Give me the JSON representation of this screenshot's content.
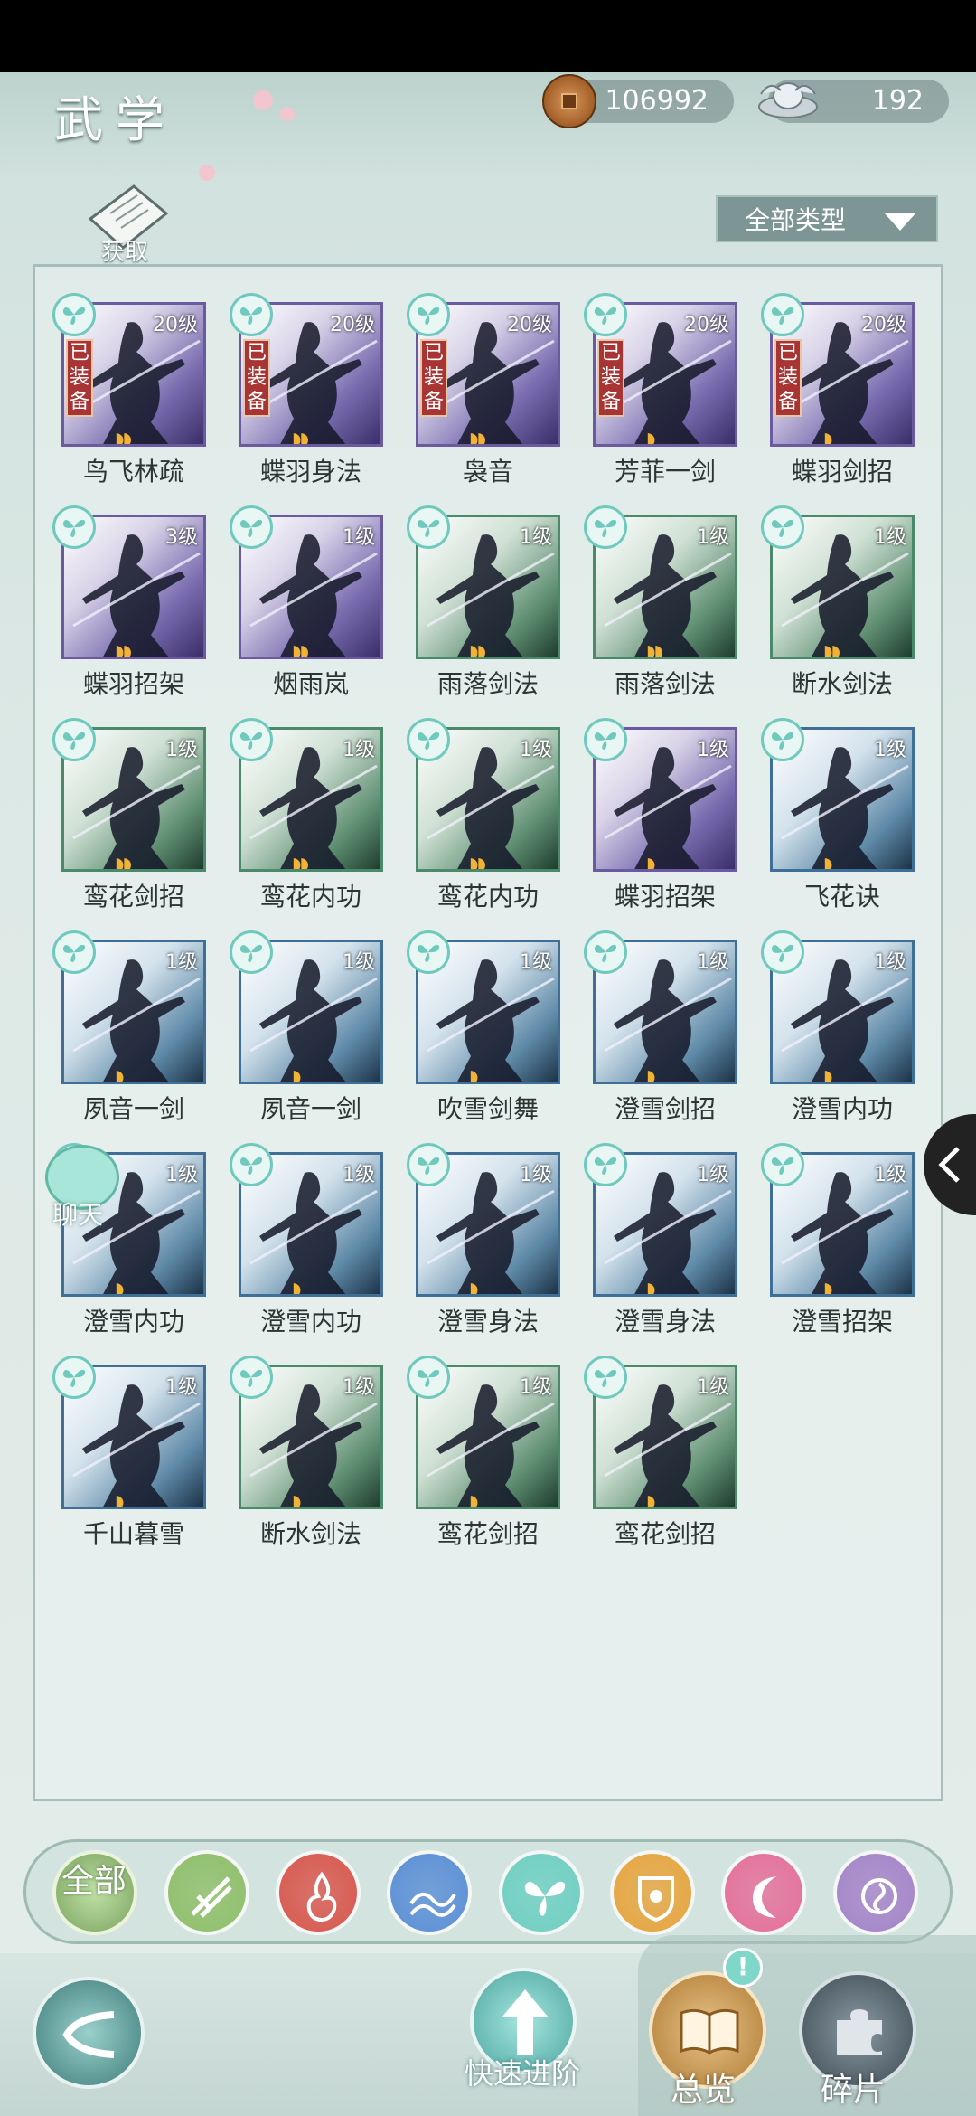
{
  "header": {
    "title": "武学",
    "copper": "106992",
    "silver": "192",
    "get_label": "获取",
    "filter_label": "全部类型"
  },
  "skills": [
    {
      "name": "鸟飞林疏",
      "level": "20级",
      "equipped": true,
      "tier": "purple",
      "flames": 2
    },
    {
      "name": "蝶羽身法",
      "level": "20级",
      "equipped": true,
      "tier": "purple",
      "flames": 2
    },
    {
      "name": "袅音",
      "level": "20级",
      "equipped": true,
      "tier": "purple",
      "flames": 2
    },
    {
      "name": "芳菲一剑",
      "level": "20级",
      "equipped": true,
      "tier": "purple",
      "flames": 1
    },
    {
      "name": "蝶羽剑招",
      "level": "20级",
      "equipped": true,
      "tier": "purple",
      "flames": 1
    },
    {
      "name": "蝶羽招架",
      "level": "3级",
      "equipped": false,
      "tier": "purple",
      "flames": 2
    },
    {
      "name": "烟雨岚",
      "level": "1级",
      "equipped": false,
      "tier": "purple",
      "flames": 2
    },
    {
      "name": "雨落剑法",
      "level": "1级",
      "equipped": false,
      "tier": "green",
      "flames": 2
    },
    {
      "name": "雨落剑法",
      "level": "1级",
      "equipped": false,
      "tier": "green",
      "flames": 2
    },
    {
      "name": "断水剑法",
      "level": "1级",
      "equipped": false,
      "tier": "green",
      "flames": 2
    },
    {
      "name": "鸾花剑招",
      "level": "1级",
      "equipped": false,
      "tier": "green",
      "flames": 2
    },
    {
      "name": "鸾花内功",
      "level": "1级",
      "equipped": false,
      "tier": "green",
      "flames": 2
    },
    {
      "name": "鸾花内功",
      "level": "1级",
      "equipped": false,
      "tier": "green",
      "flames": 2
    },
    {
      "name": "蝶羽招架",
      "level": "1级",
      "equipped": false,
      "tier": "purple",
      "flames": 1
    },
    {
      "name": "飞花诀",
      "level": "1级",
      "equipped": false,
      "tier": "blue",
      "flames": 1
    },
    {
      "name": "夙音一剑",
      "level": "1级",
      "equipped": false,
      "tier": "blue",
      "flames": 1
    },
    {
      "name": "夙音一剑",
      "level": "1级",
      "equipped": false,
      "tier": "blue",
      "flames": 1
    },
    {
      "name": "吹雪剑舞",
      "level": "1级",
      "equipped": false,
      "tier": "blue",
      "flames": 1
    },
    {
      "name": "澄雪剑招",
      "level": "1级",
      "equipped": false,
      "tier": "blue",
      "flames": 1
    },
    {
      "name": "澄雪内功",
      "level": "1级",
      "equipped": false,
      "tier": "blue",
      "flames": 1
    },
    {
      "name": "澄雪内功",
      "level": "1级",
      "equipped": false,
      "tier": "blue",
      "flames": 1
    },
    {
      "name": "澄雪内功",
      "level": "1级",
      "equipped": false,
      "tier": "blue",
      "flames": 1
    },
    {
      "name": "澄雪身法",
      "level": "1级",
      "equipped": false,
      "tier": "blue",
      "flames": 1
    },
    {
      "name": "澄雪身法",
      "level": "1级",
      "equipped": false,
      "tier": "blue",
      "flames": 1
    },
    {
      "name": "澄雪招架",
      "level": "1级",
      "equipped": false,
      "tier": "blue",
      "flames": 1
    },
    {
      "name": "千山暮雪",
      "level": "1级",
      "equipped": false,
      "tier": "blue",
      "flames": 1
    },
    {
      "name": "断水剑法",
      "level": "1级",
      "equipped": false,
      "tier": "green",
      "flames": 1
    },
    {
      "name": "鸾花剑招",
      "level": "1级",
      "equipped": false,
      "tier": "green",
      "flames": 1
    },
    {
      "name": "鸾花剑招",
      "level": "1级",
      "equipped": false,
      "tier": "green",
      "flames": 1
    }
  ],
  "equipped_label": "已装备",
  "chat_label": "聊天",
  "categories": {
    "all_label": "全部",
    "items": [
      {
        "icon": "bamboo-sect-icon",
        "color": "#8fbf6a"
      },
      {
        "icon": "flame-sect-icon",
        "color": "#d9574e"
      },
      {
        "icon": "wave-sect-icon",
        "color": "#5b8fd6"
      },
      {
        "icon": "butterfly-sect-icon",
        "color": "#6fcfc2"
      },
      {
        "icon": "shield-sect-icon",
        "color": "#e7a53f"
      },
      {
        "icon": "moon-sect-icon",
        "color": "#e56f9a"
      },
      {
        "icon": "rose-sect-icon",
        "color": "#a584c9"
      }
    ]
  },
  "bottom": {
    "quick_advance": "快速进阶",
    "overview": "总览",
    "fragments": "碎片",
    "alert": "!"
  }
}
